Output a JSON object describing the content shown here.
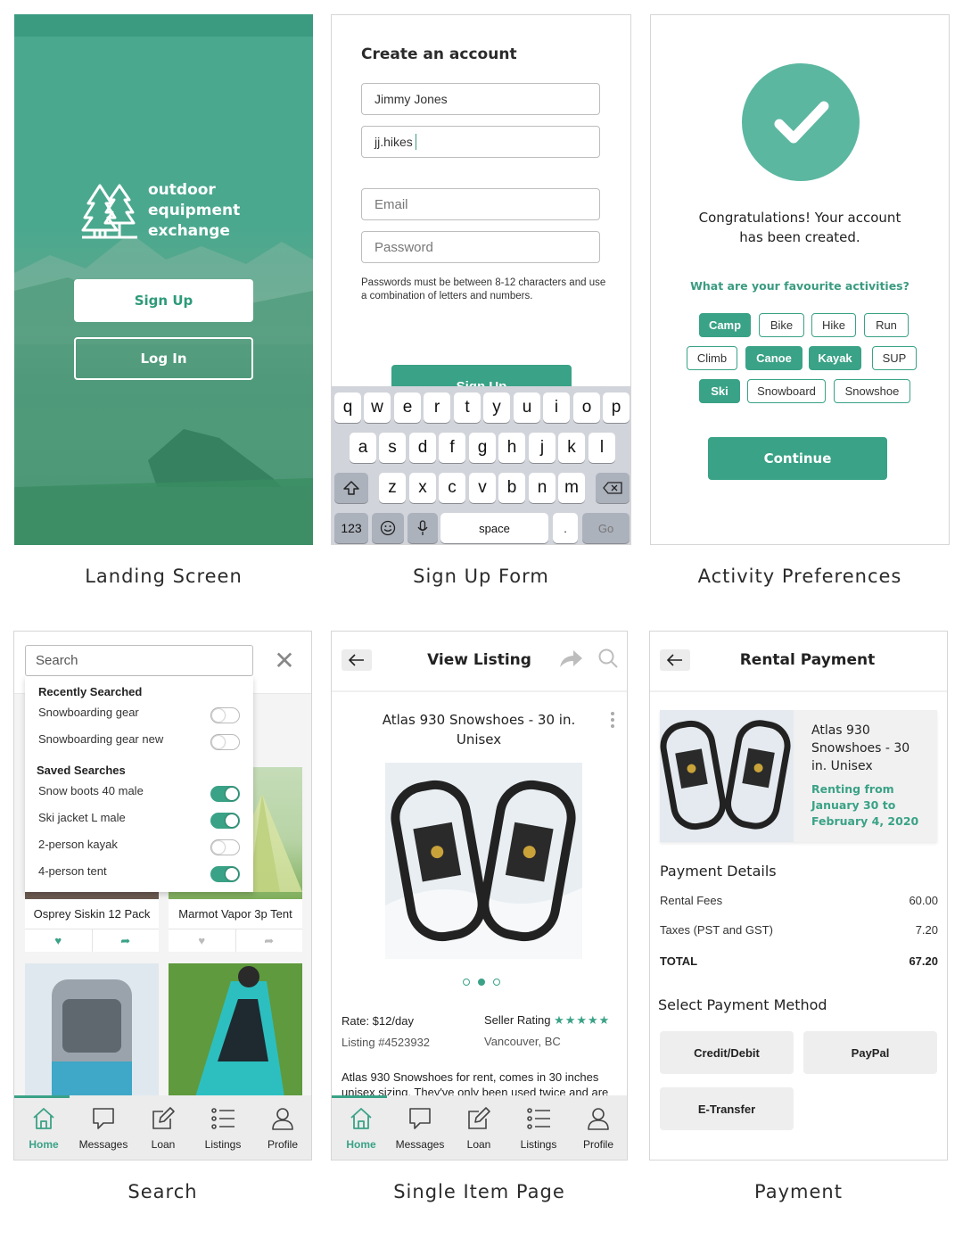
{
  "captions": {
    "landing": "Landing Screen",
    "signup": "Sign Up Form",
    "activity": "Activity Preferences",
    "search": "Search",
    "single_item": "Single Item Page",
    "payment": "Payment"
  },
  "colors": {
    "accent": "#3aa286",
    "accent_light": "#5bb7a0",
    "landing_bg": "#4aa88e"
  },
  "landing": {
    "brand_lines": [
      "outdoor",
      "equipment",
      "exchange"
    ],
    "logo_icon": "pine-trees-icon",
    "sign_up": "Sign Up",
    "log_in": "Log In"
  },
  "signup": {
    "title": "Create an account",
    "name_value": "Jimmy Jones",
    "username_value": "jj.hikes",
    "email_placeholder": "Email",
    "password_placeholder": "Password",
    "password_hint": "Passwords must be between 8-12 characters and use a combination of letters and numbers.",
    "submit": "Sign Up",
    "keyboard": {
      "row1": [
        "q",
        "w",
        "e",
        "r",
        "t",
        "y",
        "u",
        "i",
        "o",
        "p"
      ],
      "row2": [
        "a",
        "s",
        "d",
        "f",
        "g",
        "h",
        "j",
        "k",
        "l"
      ],
      "row3": [
        "z",
        "x",
        "c",
        "v",
        "b",
        "n",
        "m"
      ],
      "numbers": "123",
      "space": "space",
      "period": ".",
      "go": "Go"
    }
  },
  "activity": {
    "congrats": "Congratulations! Your account has been created.",
    "question": "What are your favourite activities?",
    "chips": [
      {
        "label": "Camp",
        "selected": true
      },
      {
        "label": "Bike",
        "selected": false
      },
      {
        "label": "Hike",
        "selected": false
      },
      {
        "label": "Run",
        "selected": false
      },
      {
        "label": "Climb",
        "selected": false
      },
      {
        "label": "Canoe",
        "selected": true
      },
      {
        "label": "Kayak",
        "selected": true
      },
      {
        "label": "SUP",
        "selected": false
      },
      {
        "label": "Ski",
        "selected": true
      },
      {
        "label": "Snowboard",
        "selected": false
      },
      {
        "label": "Snowshoe",
        "selected": false
      }
    ],
    "continue": "Continue"
  },
  "search": {
    "placeholder": "Search",
    "recent_heading": "Recently Searched",
    "recent": [
      {
        "label": "Snowboarding gear",
        "on": false
      },
      {
        "label": "Snowboarding gear new",
        "on": false
      }
    ],
    "saved_heading": "Saved Searches",
    "saved": [
      {
        "label": "Snow boots 40 male",
        "on": true
      },
      {
        "label": "Ski jacket L male",
        "on": true
      },
      {
        "label": "2-person kayak",
        "on": false
      },
      {
        "label": "4-person tent",
        "on": true
      }
    ],
    "cards": [
      {
        "title": "Osprey Siskin 12 Pack",
        "liked": true
      },
      {
        "title": "Marmot Vapor 3p Tent",
        "liked": false
      }
    ]
  },
  "tabs": [
    "Home",
    "Messages",
    "Loan",
    "Listings",
    "Profile"
  ],
  "listing": {
    "header": "View Listing",
    "title": "Atlas 930 Snowshoes - 30 in. Unisex",
    "rate": "Rate: $12/day",
    "listing_no": "Listing #4523932",
    "seller_rating_label": "Seller Rating",
    "stars": "★★★★★",
    "location": "Vancouver, BC",
    "description": "Atlas 930 Snowshoes for rent, comes in 30 inches unisex sizing. They've only been used twice and are",
    "carousel_total": 3,
    "carousel_active": 2
  },
  "payment": {
    "header": "Rental Payment",
    "item_name": "Atlas 930 Snowshoes - 30 in. Unisex",
    "dates": "Renting from January 30 to February 4, 2020",
    "details_heading": "Payment Details",
    "rows": [
      {
        "label": "Rental Fees",
        "value": "60.00"
      },
      {
        "label": "Taxes (PST and GST)",
        "value": "7.20"
      }
    ],
    "total_label": "TOTAL",
    "total_value": "67.20",
    "method_heading": "Select Payment Method",
    "methods": [
      "Credit/Debit",
      "PayPal",
      "E-Transfer"
    ]
  }
}
